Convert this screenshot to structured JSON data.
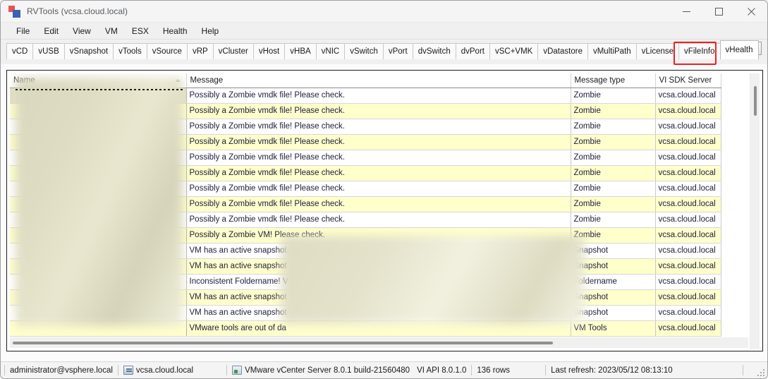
{
  "window": {
    "title": "RVTools (vcsa.cloud.local)",
    "icon": "rvtools-app-icon",
    "controls": {
      "minimize": "minimize-icon",
      "maximize": "maximize-icon",
      "close": "close-icon"
    }
  },
  "menu": {
    "items": [
      "File",
      "Edit",
      "View",
      "VM",
      "ESX",
      "Health",
      "Help"
    ]
  },
  "tabs": {
    "items": [
      "vCD",
      "vUSB",
      "vSnapshot",
      "vTools",
      "vSource",
      "vRP",
      "vCluster",
      "vHost",
      "vHBA",
      "vNIC",
      "vSwitch",
      "vPort",
      "dvSwitch",
      "dvPort",
      "vSC+VMK",
      "vDatastore",
      "vMultiPath",
      "vLicense",
      "vFileInfo",
      "vHealth"
    ],
    "selected": "vHealth",
    "scroll_left": "◄",
    "scroll_right": "►",
    "highlight_color": "#ee2222"
  },
  "grid": {
    "columns": [
      "Name",
      "Message",
      "Message type",
      "VI SDK Server"
    ],
    "sort_column": "Name",
    "sort_direction": "ascending",
    "name_column_redacted": true,
    "rows": [
      {
        "name": "",
        "message": "Possibly a Zombie vmdk file! Please check.",
        "type": "Zombie",
        "sdk": "vcsa.cloud.local"
      },
      {
        "name": "",
        "message": "Possibly a Zombie vmdk file! Please check.",
        "type": "Zombie",
        "sdk": "vcsa.cloud.local"
      },
      {
        "name": "",
        "message": "Possibly a Zombie vmdk file! Please check.",
        "type": "Zombie",
        "sdk": "vcsa.cloud.local"
      },
      {
        "name": "",
        "message": "Possibly a Zombie vmdk file! Please check.",
        "type": "Zombie",
        "sdk": "vcsa.cloud.local"
      },
      {
        "name": "",
        "message": "Possibly a Zombie vmdk file! Please check.",
        "type": "Zombie",
        "sdk": "vcsa.cloud.local"
      },
      {
        "name": "",
        "message": "Possibly a Zombie vmdk file! Please check.",
        "type": "Zombie",
        "sdk": "vcsa.cloud.local"
      },
      {
        "name": "",
        "message": "Possibly a Zombie vmdk file! Please check.",
        "type": "Zombie",
        "sdk": "vcsa.cloud.local"
      },
      {
        "name": "",
        "message": "Possibly a Zombie vmdk file! Please check.",
        "type": "Zombie",
        "sdk": "vcsa.cloud.local"
      },
      {
        "name": "",
        "message": "Possibly a Zombie vmdk file! Please check.",
        "type": "Zombie",
        "sdk": "vcsa.cloud.local"
      },
      {
        "name": "",
        "message": "Possibly a Zombie VM! Please check.",
        "type": "Zombie",
        "sdk": "vcsa.cloud.local"
      },
      {
        "name": "",
        "message": "VM has an active snapshot",
        "type": "Snapshot",
        "sdk": "vcsa.cloud.local"
      },
      {
        "name": "",
        "message": "VM has an active snapshot",
        "type": "Snapshot",
        "sdk": "vcsa.cloud.local"
      },
      {
        "name": "",
        "message": "Inconsistent Foldername! V",
        "type": "Foldername",
        "sdk": "vcsa.cloud.local"
      },
      {
        "name": "",
        "message": "VM has an active snapshot",
        "type": "Snapshot",
        "sdk": "vcsa.cloud.local"
      },
      {
        "name": "",
        "message": "VM has an active snapshot",
        "type": "Snapshot",
        "sdk": "vcsa.cloud.local"
      },
      {
        "name": "",
        "message": "VMware tools are out of da",
        "type": "VM Tools",
        "sdk": "vcsa.cloud.local"
      }
    ]
  },
  "status_bar": {
    "user": "administrator@vsphere.local",
    "server": "vcsa.cloud.local",
    "product": "VMware vCenter Server 8.0.1 build-21560480",
    "api": "VI API 8.0.1.0",
    "row_count": "136 rows",
    "last_refresh": "Last refresh: 2023/05/12 08:13:10"
  }
}
